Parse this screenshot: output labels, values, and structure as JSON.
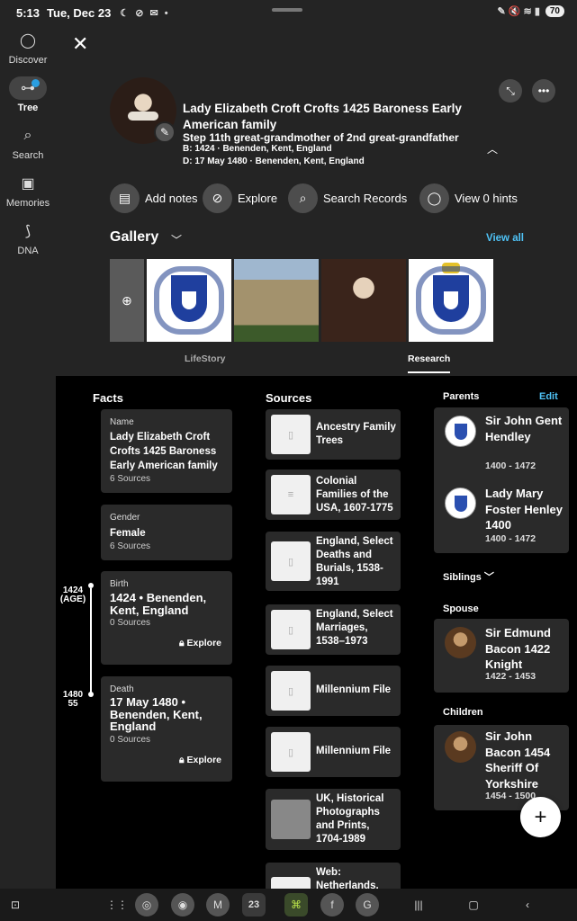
{
  "status": {
    "time": "5:13",
    "date": "Tue, Dec 23",
    "icons": "☾ ⊘ ✉ •",
    "right_icons": "✎ 🔇 ≋ ▮",
    "battery": "70"
  },
  "nav": {
    "items": [
      {
        "label": "Discover",
        "icon": "chat-bubble-icon"
      },
      {
        "label": "Tree",
        "icon": "tree-icon"
      },
      {
        "label": "Search",
        "icon": "search-icon"
      },
      {
        "label": "Memories",
        "icon": "photos-icon"
      },
      {
        "label": "DNA",
        "icon": "dna-icon"
      }
    ]
  },
  "profile": {
    "name": "Lady Elizabeth Croft Crofts 1425 Baroness Early American family",
    "relationship": "Step 11th great-grandmother of 2nd great-grandfather",
    "birth": "B: 1424 · Benenden, Kent, England",
    "death": "D: 17 May 1480 · Benenden, Kent, England"
  },
  "actions": {
    "add_notes": "Add notes",
    "explore": "Explore",
    "search_records": "Search Records",
    "view_hints": "View 0 hints"
  },
  "gallery": {
    "title": "Gallery",
    "view_all": "View all"
  },
  "tabs": {
    "lifestory": "LifeStory",
    "research": "Research"
  },
  "facts": {
    "title": "Facts",
    "name": {
      "label": "Name",
      "value": "Lady Elizabeth Croft Crofts 1425 Baroness Early American family",
      "sources": "6 Sources"
    },
    "gender": {
      "label": "Gender",
      "value": "Female",
      "sources": "6 Sources"
    },
    "birth": {
      "label": "Birth",
      "value": "1424 • Benenden, Kent, England",
      "sources": "0 Sources",
      "explore": "Explore"
    },
    "death": {
      "label": "Death",
      "value": "17 May 1480 • Benenden, Kent, England",
      "sources": "0 Sources",
      "explore": "Explore"
    },
    "timeline": {
      "birth_year": "1424",
      "birth_age": "(AGE)",
      "death_year": "1480",
      "death_age": "55"
    }
  },
  "sources": {
    "title": "Sources",
    "items": [
      "Ancestry Family Trees",
      "Colonial Families of the USA, 1607-1775",
      "England, Select Deaths and Burials, 1538-1991",
      "England, Select Marriages, 1538–1973",
      "Millennium File",
      "Millennium File",
      "UK, Historical Photographs and Prints, 1704-1989",
      "Web: Netherlands,"
    ]
  },
  "family": {
    "parents_title": "Parents",
    "edit": "Edit",
    "parents": [
      {
        "name": "Sir John Gent Hendley",
        "dates": "1400 - 1472"
      },
      {
        "name": "Lady Mary Foster Henley 1400",
        "dates": "1400 - 1472"
      }
    ],
    "siblings_title": "Siblings",
    "spouse_title": "Spouse",
    "spouse": {
      "name": "Sir Edmund Bacon 1422 Knight",
      "dates": "1422 - 1453"
    },
    "children_title": "Children",
    "child": {
      "name": "Sir John Bacon 1454 Sheriff Of Yorkshire",
      "dates": "1454 - 1500"
    }
  },
  "bottom": {
    "calendar_day": "23"
  }
}
